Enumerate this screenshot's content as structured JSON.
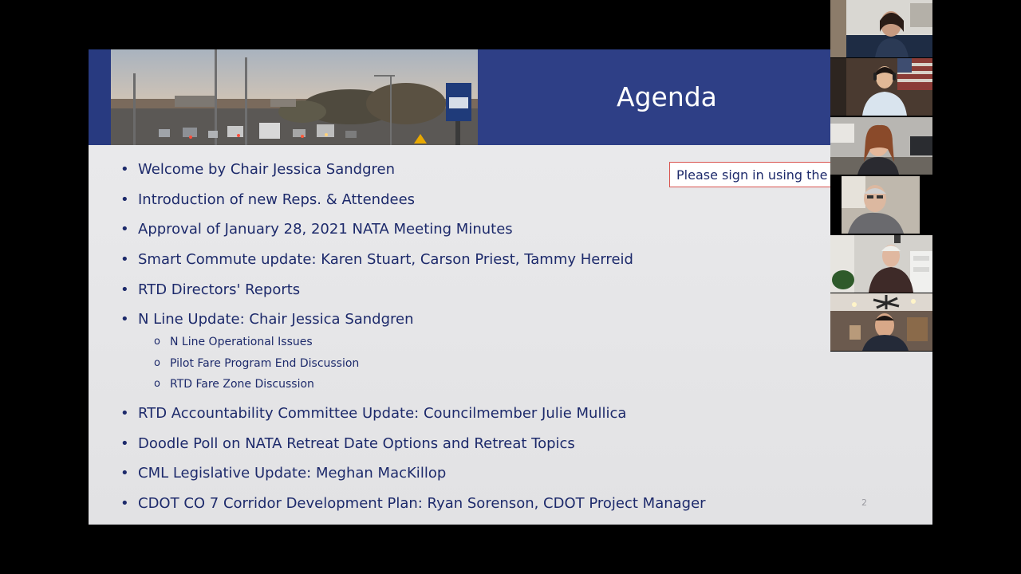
{
  "slide": {
    "title": "Agenda",
    "notice": "Please sign in using the",
    "page_number": "2",
    "items": [
      {
        "text": "Welcome by Chair Jessica Sandgren"
      },
      {
        "text": "Introduction of new Reps. & Attendees"
      },
      {
        "text": "Approval of January 28, 2021 NATA Meeting Minutes"
      },
      {
        "text": "Smart Commute update: Karen Stuart, Carson Priest, Tammy Herreid"
      },
      {
        "text": "RTD Directors' Reports"
      },
      {
        "text": "N Line Update: Chair Jessica Sandgren"
      },
      {
        "text": "RTD Accountability Committee Update: Councilmember Julie Mullica"
      },
      {
        "text": "Doodle Poll on NATA Retreat Date Options and Retreat Topics"
      },
      {
        "text": "CML Legislative Update: Meghan MacKillop"
      },
      {
        "text": "CDOT CO 7 Corridor Development Plan: Ryan Sorenson, CDOT Project Manager"
      }
    ],
    "sub_items": [
      {
        "text": "N Line Operational Issues"
      },
      {
        "text": "Pilot Fare Program End Discussion"
      },
      {
        "text": "RTD Fare Zone Discussion"
      }
    ],
    "bullet": "•",
    "sub_bullet": "o"
  },
  "colors": {
    "banner": "#2e3f86",
    "text": "#1d2a6b",
    "notice_border": "#d9534f"
  },
  "participants": [
    {
      "icon": "participant-video-icon"
    },
    {
      "icon": "participant-video-icon"
    },
    {
      "icon": "participant-video-icon"
    },
    {
      "icon": "participant-video-icon"
    },
    {
      "icon": "participant-video-icon"
    },
    {
      "icon": "participant-video-icon"
    }
  ]
}
